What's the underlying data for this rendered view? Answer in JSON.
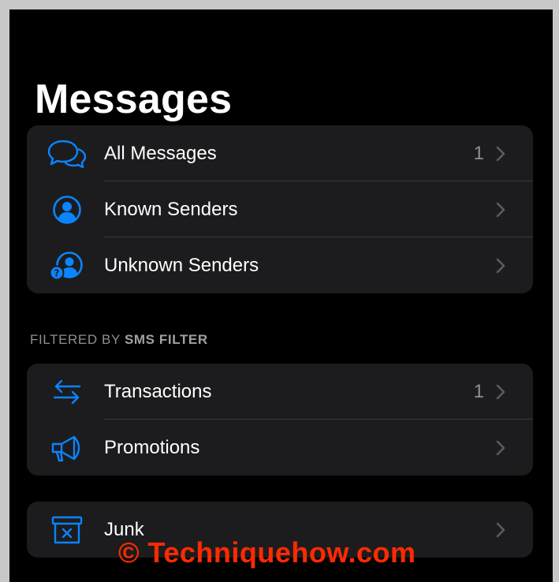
{
  "page": {
    "title": "Messages"
  },
  "colors": {
    "accent": "#0a84ff",
    "background": "#000000",
    "group_bg": "#1c1c1e",
    "watermark": "#ff2a00"
  },
  "group_main": [
    {
      "icon": "chat-bubbles-icon",
      "label": "All Messages",
      "count": "1"
    },
    {
      "icon": "person-circle-icon",
      "label": "Known Senders",
      "count": ""
    },
    {
      "icon": "person-question-icon",
      "label": "Unknown Senders",
      "count": ""
    }
  ],
  "section_filter": {
    "prefix": "FILTERED BY",
    "emphasis": "SMS FILTER"
  },
  "group_filter": [
    {
      "icon": "arrows-exchange-icon",
      "label": "Transactions",
      "count": "1"
    },
    {
      "icon": "megaphone-icon",
      "label": "Promotions",
      "count": ""
    }
  ],
  "group_junk": [
    {
      "icon": "junk-bin-icon",
      "label": "Junk",
      "count": ""
    }
  ],
  "watermark": {
    "text": "© Techniquehow.com"
  }
}
